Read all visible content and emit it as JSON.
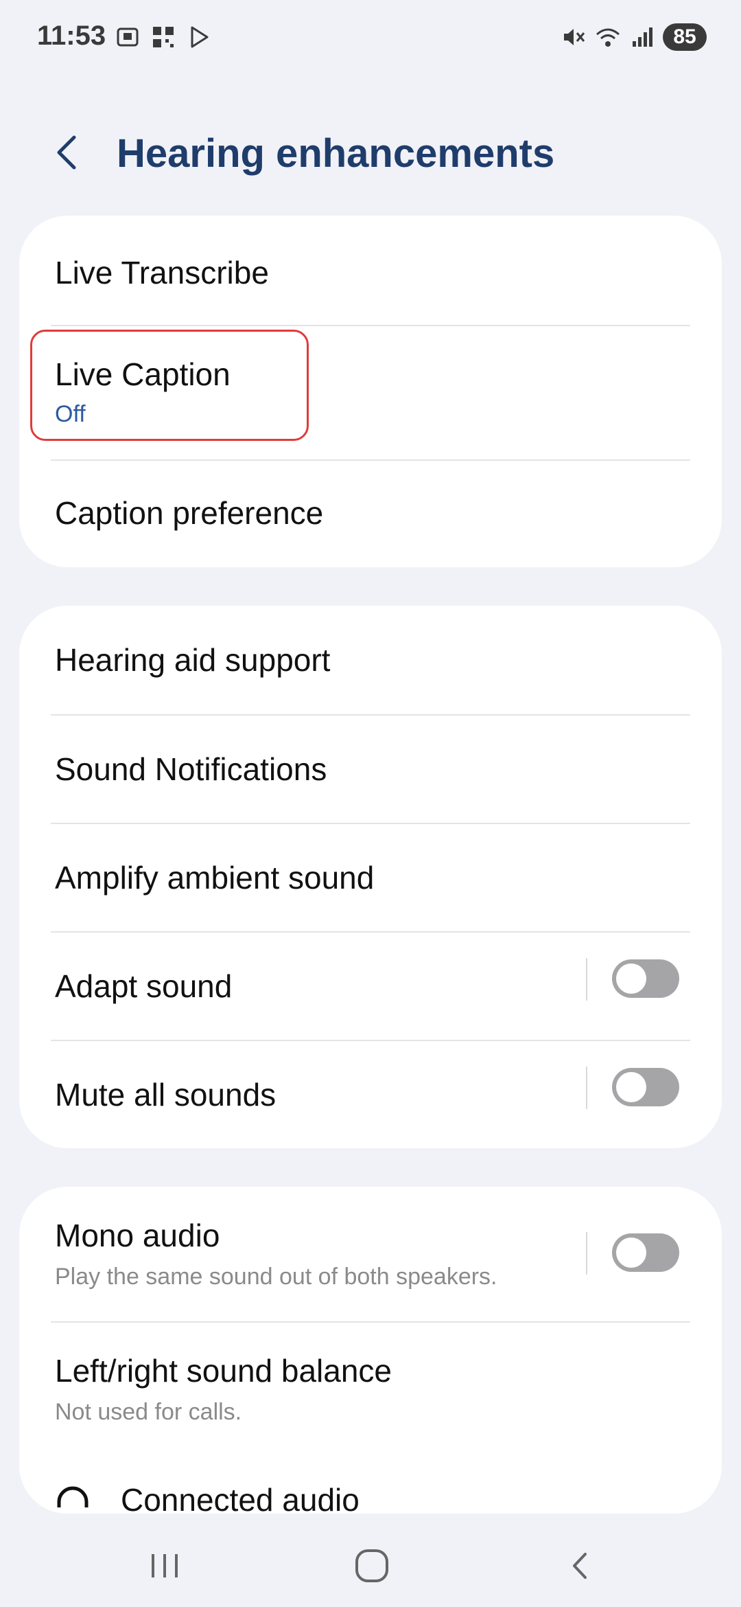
{
  "status_bar": {
    "time": "11:53",
    "battery": "85",
    "icons": [
      "screenshot-icon",
      "qr-icon",
      "play-store-icon",
      "mute-icon",
      "wifi-icon",
      "signal-icon"
    ]
  },
  "header": {
    "title": "Hearing enhancements"
  },
  "group1": [
    {
      "label": "Live Transcribe"
    },
    {
      "label": "Live Caption",
      "sub": "Off"
    },
    {
      "label": "Caption preference"
    }
  ],
  "group2": [
    {
      "label": "Hearing aid support"
    },
    {
      "label": "Sound Notifications"
    },
    {
      "label": "Amplify ambient sound"
    },
    {
      "label": "Adapt sound",
      "toggle": "off"
    },
    {
      "label": "Mute all sounds",
      "toggle": "off"
    }
  ],
  "group3": [
    {
      "label": "Mono audio",
      "sub": "Play the same sound out of both speakers.",
      "toggle": "off"
    },
    {
      "label": "Left/right sound balance",
      "sub": "Not used for calls."
    },
    {
      "label": "Connected audio"
    }
  ],
  "colors": {
    "title": "#1f3d6b",
    "accent_sub": "#2b5aa0",
    "highlight": "#e03b3b",
    "background": "#f1f2f7"
  }
}
